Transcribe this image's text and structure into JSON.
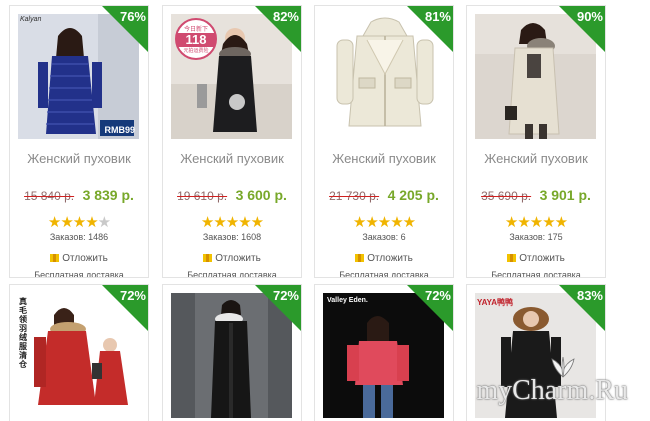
{
  "products": [
    {
      "discount": "76%",
      "title": "Женский пуховик",
      "old_price": "15 840 р.",
      "price": "3 839 р.",
      "rating": 4,
      "orders": "Заказов: 1486",
      "defer_label": "Отложить",
      "shipping": "Бесплатная доставка",
      "photo": {
        "bg": "#d9dde6",
        "coat": "#22318a",
        "skin": "#e8c8b0",
        "logo": "Kalyan",
        "promo": "RMB99"
      }
    },
    {
      "discount": "82%",
      "title": "Женский пуховик",
      "old_price": "19 610 р.",
      "price": "3 600 р.",
      "rating": 5,
      "orders": "Заказов: 1608",
      "defer_label": "Отложить",
      "shipping": "Бесплатная доставка",
      "photo": {
        "bg": "#e7e2dc",
        "coat": "#1d1d1f",
        "skin": "#e8c8b0",
        "promo_top": "今日新下",
        "promo_num": "118",
        "promo_bottom": "元拍运费险"
      }
    },
    {
      "discount": "81%",
      "title": "Женский пуховик",
      "old_price": "21 730 р.",
      "price": "4 205 р.",
      "rating": 5,
      "orders": "Заказов: 6",
      "defer_label": "Отложить",
      "shipping": "Бесплатная доставка",
      "photo": {
        "bg": "#ffffff",
        "coat": "#ece8d8",
        "skin": "#ffffff"
      }
    },
    {
      "discount": "90%",
      "title": "Женский пуховик",
      "old_price": "35 690 р.",
      "price": "3 901 р.",
      "rating": 5,
      "orders": "Заказов: 175",
      "defer_label": "Отложить",
      "shipping": "Бесплатная доставка",
      "photo": {
        "bg": "#dcd6cf",
        "coat": "#e6e0d2",
        "skin": "#e8c8b0"
      }
    },
    {
      "discount": "72%",
      "photo": {
        "bg": "#ffffff",
        "coat": "#c42c2a",
        "skin": "#e8c8b0",
        "side_text": "真毛领羽绒服清仓"
      }
    },
    {
      "discount": "72%",
      "photo": {
        "bg": "#6b6e72",
        "coat": "#161616",
        "skin": "#e8c8b0"
      }
    },
    {
      "discount": "72%",
      "photo": {
        "bg": "#0c0c0c",
        "coat": "#e04a5c",
        "skin": "#e8c8b0",
        "logo": "Valley Eden."
      }
    },
    {
      "discount": "83%",
      "photo": {
        "bg": "#e8e6e4",
        "coat": "#1a1a1a",
        "skin": "#e8c8b0",
        "logo": "YAYA鸭鸭"
      }
    }
  ],
  "watermark": "myCharm.Ru",
  "colors": {
    "badge": "#2b9a2b",
    "price": "#78a82a",
    "star": "#f0b400"
  }
}
